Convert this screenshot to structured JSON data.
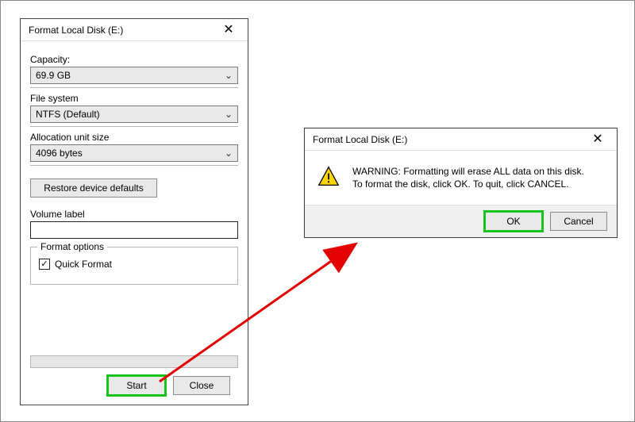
{
  "format_dialog": {
    "title": "Format Local Disk (E:)",
    "close_glyph": "✕",
    "capacity_label": "Capacity:",
    "capacity_value": "69.9 GB",
    "filesystem_label": "File system",
    "filesystem_value": "NTFS (Default)",
    "allocation_label": "Allocation unit size",
    "allocation_value": "4096 bytes",
    "restore_label": "Restore device defaults",
    "volume_label": "Volume label",
    "volume_value": "",
    "options_group_label": "Format options",
    "quick_format_label": "Quick Format",
    "quick_format_checked": true,
    "start_label": "Start",
    "close_label": "Close",
    "chevron_glyph": "⌄",
    "check_glyph": "✓"
  },
  "confirm_dialog": {
    "title": "Format Local Disk (E:)",
    "close_glyph": "✕",
    "message_line1": "WARNING: Formatting will erase ALL data on this disk.",
    "message_line2": "To format the disk, click OK. To quit, click CANCEL.",
    "ok_label": "OK",
    "cancel_label": "Cancel"
  },
  "annotation": {
    "arrow_color": "#e30000",
    "highlight_color": "#17c41f"
  }
}
